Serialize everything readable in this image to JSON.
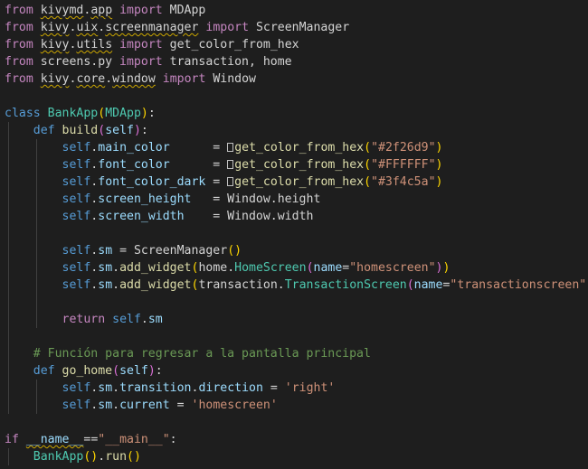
{
  "colors": {
    "background": "#1e1e1e",
    "keyword": "#c586c0",
    "storage": "#569cd6",
    "class_name": "#4ec9b0",
    "function": "#dcdcaa",
    "variable": "#9cdcfe",
    "self": "#569cd6",
    "string": "#ce9178",
    "comment": "#6a9955",
    "plain": "#d4d4d4",
    "paren_gold": "#ffd700",
    "paren_pink": "#da70d6",
    "paren_blue": "#179fff",
    "squiggle": "#cca700"
  },
  "lines": [
    {
      "indent": 0,
      "tokens": [
        {
          "t": "from",
          "c": "keyword"
        },
        {
          "t": " "
        },
        {
          "t": "kivymd",
          "c": "plain",
          "squig": true
        },
        {
          "t": "."
        },
        {
          "t": "app",
          "c": "plain",
          "squig": true
        },
        {
          "t": " "
        },
        {
          "t": "import",
          "c": "keyword"
        },
        {
          "t": " MDApp",
          "c": "plain"
        }
      ]
    },
    {
      "indent": 0,
      "tokens": [
        {
          "t": "from",
          "c": "keyword"
        },
        {
          "t": " "
        },
        {
          "t": "kivy",
          "c": "plain",
          "squig": true
        },
        {
          "t": "."
        },
        {
          "t": "uix",
          "c": "plain",
          "squig": true
        },
        {
          "t": "."
        },
        {
          "t": "screenmanager",
          "c": "plain",
          "squig": true
        },
        {
          "t": " "
        },
        {
          "t": "import",
          "c": "keyword"
        },
        {
          "t": " ScreenManager",
          "c": "plain"
        }
      ]
    },
    {
      "indent": 0,
      "tokens": [
        {
          "t": "from",
          "c": "keyword"
        },
        {
          "t": " "
        },
        {
          "t": "kivy",
          "c": "plain",
          "squig": true
        },
        {
          "t": "."
        },
        {
          "t": "utils",
          "c": "plain",
          "squig": true
        },
        {
          "t": " "
        },
        {
          "t": "import",
          "c": "keyword"
        },
        {
          "t": " get_color_from_hex",
          "c": "plain"
        }
      ]
    },
    {
      "indent": 0,
      "tokens": [
        {
          "t": "from",
          "c": "keyword"
        },
        {
          "t": " screens.py ",
          "c": "plain"
        },
        {
          "t": "import",
          "c": "keyword"
        },
        {
          "t": " transaction, home",
          "c": "plain"
        }
      ]
    },
    {
      "indent": 0,
      "tokens": [
        {
          "t": "from",
          "c": "keyword"
        },
        {
          "t": " "
        },
        {
          "t": "kivy",
          "c": "plain",
          "squig": true
        },
        {
          "t": "."
        },
        {
          "t": "core",
          "c": "plain",
          "squig": true
        },
        {
          "t": "."
        },
        {
          "t": "window",
          "c": "plain",
          "squig": true
        },
        {
          "t": " "
        },
        {
          "t": "import",
          "c": "keyword"
        },
        {
          "t": " Window",
          "c": "plain"
        }
      ]
    },
    {
      "indent": 0,
      "tokens": []
    },
    {
      "indent": 0,
      "tokens": [
        {
          "t": "class",
          "c": "storage"
        },
        {
          "t": " "
        },
        {
          "t": "BankApp",
          "c": "class_name"
        },
        {
          "t": "(",
          "c": "paren_gold"
        },
        {
          "t": "MDApp",
          "c": "class_name"
        },
        {
          "t": ")",
          "c": "paren_gold"
        },
        {
          "t": ":",
          "c": "plain"
        }
      ]
    },
    {
      "indent": 1,
      "tokens": [
        {
          "t": "def",
          "c": "storage"
        },
        {
          "t": " "
        },
        {
          "t": "build",
          "c": "function"
        },
        {
          "t": "(",
          "c": "paren_pink"
        },
        {
          "t": "self",
          "c": "variable"
        },
        {
          "t": ")",
          "c": "paren_pink"
        },
        {
          "t": ":",
          "c": "plain"
        }
      ]
    },
    {
      "indent": 2,
      "tokens": [
        {
          "t": "self",
          "c": "self"
        },
        {
          "t": "."
        },
        {
          "t": "main_color",
          "c": "variable"
        },
        {
          "t": "      = ",
          "c": "plain"
        },
        {
          "t": "",
          "c": "plain",
          "box": true
        },
        {
          "t": "get_color_from_hex",
          "c": "function"
        },
        {
          "t": "(",
          "c": "paren_gold"
        },
        {
          "t": "\"#2f26d9\"",
          "c": "string"
        },
        {
          "t": ")",
          "c": "paren_gold"
        }
      ]
    },
    {
      "indent": 2,
      "tokens": [
        {
          "t": "self",
          "c": "self"
        },
        {
          "t": "."
        },
        {
          "t": "font_color",
          "c": "variable"
        },
        {
          "t": "      = ",
          "c": "plain"
        },
        {
          "t": "",
          "c": "plain",
          "box": true
        },
        {
          "t": "get_color_from_hex",
          "c": "function"
        },
        {
          "t": "(",
          "c": "paren_gold"
        },
        {
          "t": "\"#FFFFFF\"",
          "c": "string"
        },
        {
          "t": ")",
          "c": "paren_gold"
        }
      ]
    },
    {
      "indent": 2,
      "tokens": [
        {
          "t": "self",
          "c": "self"
        },
        {
          "t": "."
        },
        {
          "t": "font_color_dark",
          "c": "variable"
        },
        {
          "t": " = ",
          "c": "plain"
        },
        {
          "t": "",
          "c": "plain",
          "box": true
        },
        {
          "t": "get_color_from_hex",
          "c": "function"
        },
        {
          "t": "(",
          "c": "paren_gold"
        },
        {
          "t": "\"#3f4c5a\"",
          "c": "string"
        },
        {
          "t": ")",
          "c": "paren_gold"
        }
      ]
    },
    {
      "indent": 2,
      "tokens": [
        {
          "t": "self",
          "c": "self"
        },
        {
          "t": "."
        },
        {
          "t": "screen_height",
          "c": "variable"
        },
        {
          "t": "   = Window.height",
          "c": "plain"
        }
      ]
    },
    {
      "indent": 2,
      "tokens": [
        {
          "t": "self",
          "c": "self"
        },
        {
          "t": "."
        },
        {
          "t": "screen_width",
          "c": "variable"
        },
        {
          "t": "    = Window.width",
          "c": "plain"
        }
      ]
    },
    {
      "indent": 2,
      "tokens": []
    },
    {
      "indent": 2,
      "tokens": [
        {
          "t": "self",
          "c": "self"
        },
        {
          "t": "."
        },
        {
          "t": "sm",
          "c": "variable"
        },
        {
          "t": " = ScreenManager",
          "c": "plain"
        },
        {
          "t": "()",
          "c": "paren_gold"
        }
      ]
    },
    {
      "indent": 2,
      "tokens": [
        {
          "t": "self",
          "c": "self"
        },
        {
          "t": "."
        },
        {
          "t": "sm",
          "c": "variable"
        },
        {
          "t": "."
        },
        {
          "t": "add_widget",
          "c": "function"
        },
        {
          "t": "(",
          "c": "paren_gold"
        },
        {
          "t": "home.",
          "c": "plain"
        },
        {
          "t": "HomeScreen",
          "c": "class_name"
        },
        {
          "t": "(",
          "c": "paren_pink"
        },
        {
          "t": "name",
          "c": "variable"
        },
        {
          "t": "="
        },
        {
          "t": "\"homescreen\"",
          "c": "string"
        },
        {
          "t": ")",
          "c": "paren_pink"
        },
        {
          "t": ")",
          "c": "paren_gold"
        }
      ]
    },
    {
      "indent": 2,
      "tokens": [
        {
          "t": "self",
          "c": "self"
        },
        {
          "t": "."
        },
        {
          "t": "sm",
          "c": "variable"
        },
        {
          "t": "."
        },
        {
          "t": "add_widget",
          "c": "function"
        },
        {
          "t": "(",
          "c": "paren_gold"
        },
        {
          "t": "transaction.",
          "c": "plain"
        },
        {
          "t": "TransactionScreen",
          "c": "class_name"
        },
        {
          "t": "(",
          "c": "paren_pink"
        },
        {
          "t": "name",
          "c": "variable"
        },
        {
          "t": "="
        },
        {
          "t": "\"transactionscreen\"",
          "c": "string"
        },
        {
          "t": ")",
          "c": "paren_pink"
        },
        {
          "t": ")",
          "c": "paren_gold"
        }
      ]
    },
    {
      "indent": 2,
      "tokens": []
    },
    {
      "indent": 2,
      "tokens": [
        {
          "t": "return",
          "c": "keyword"
        },
        {
          "t": " "
        },
        {
          "t": "self",
          "c": "self"
        },
        {
          "t": "."
        },
        {
          "t": "sm",
          "c": "variable"
        }
      ]
    },
    {
      "indent": 1,
      "tokens": []
    },
    {
      "indent": 1,
      "tokens": [
        {
          "t": "# Función para regresar a la pantalla principal",
          "c": "comment"
        }
      ]
    },
    {
      "indent": 1,
      "tokens": [
        {
          "t": "def",
          "c": "storage"
        },
        {
          "t": " "
        },
        {
          "t": "go_home",
          "c": "function"
        },
        {
          "t": "(",
          "c": "paren_pink"
        },
        {
          "t": "self",
          "c": "variable"
        },
        {
          "t": ")",
          "c": "paren_pink"
        },
        {
          "t": ":",
          "c": "plain"
        }
      ]
    },
    {
      "indent": 2,
      "tokens": [
        {
          "t": "self",
          "c": "self"
        },
        {
          "t": "."
        },
        {
          "t": "sm",
          "c": "variable"
        },
        {
          "t": "."
        },
        {
          "t": "transition",
          "c": "variable"
        },
        {
          "t": "."
        },
        {
          "t": "direction",
          "c": "variable"
        },
        {
          "t": " = ",
          "c": "plain"
        },
        {
          "t": "'right'",
          "c": "string"
        }
      ]
    },
    {
      "indent": 2,
      "tokens": [
        {
          "t": "self",
          "c": "self"
        },
        {
          "t": "."
        },
        {
          "t": "sm",
          "c": "variable"
        },
        {
          "t": "."
        },
        {
          "t": "current",
          "c": "variable"
        },
        {
          "t": " = ",
          "c": "plain"
        },
        {
          "t": "'homescreen'",
          "c": "string"
        }
      ]
    },
    {
      "indent": 0,
      "tokens": []
    },
    {
      "indent": 0,
      "tokens": [
        {
          "t": "if",
          "c": "keyword"
        },
        {
          "t": " "
        },
        {
          "t": "__name__",
          "c": "variable",
          "squig": true
        },
        {
          "t": "=="
        },
        {
          "t": "\"__main__\"",
          "c": "string"
        },
        {
          "t": ":",
          "c": "plain"
        }
      ]
    },
    {
      "indent": 1,
      "tokens": [
        {
          "t": "BankApp",
          "c": "class_name"
        },
        {
          "t": "()",
          "c": "paren_gold"
        },
        {
          "t": "."
        },
        {
          "t": "run",
          "c": "function"
        },
        {
          "t": "()",
          "c": "paren_gold"
        }
      ]
    }
  ]
}
